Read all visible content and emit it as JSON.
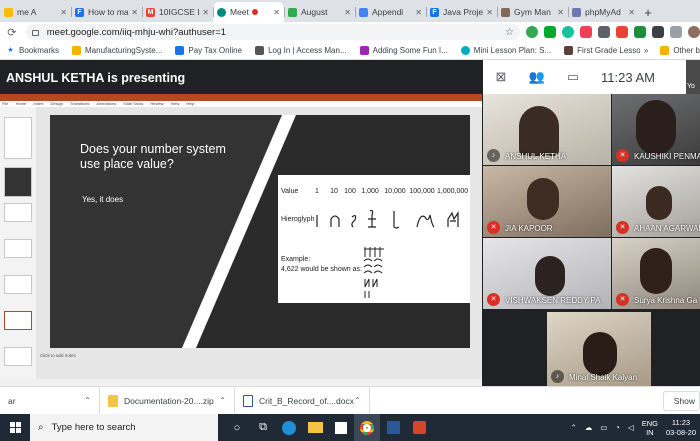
{
  "browser": {
    "tabs": [
      {
        "label": "me A",
        "favicon_color": "#fbbc04",
        "favicon_text": ""
      },
      {
        "label": "How to ma",
        "favicon_color": "#1a73e8",
        "favicon_text": "F"
      },
      {
        "label": "10IGCSE In",
        "favicon_color": "#ea4335",
        "favicon_text": "M"
      },
      {
        "label": "Meet",
        "favicon_color": "#00897b",
        "favicon_text": ""
      },
      {
        "label": "August",
        "favicon_color": "#34a853",
        "favicon_text": ""
      },
      {
        "label": "Appendi",
        "favicon_color": "#4285f4",
        "favicon_text": ""
      },
      {
        "label": "Java Proje",
        "favicon_color": "#1a73e8",
        "favicon_text": "F"
      },
      {
        "label": "Gym Man",
        "favicon_color": "#7f6a55",
        "favicon_text": ""
      },
      {
        "label": "phpMyAd",
        "favicon_color": "#6c78af",
        "favicon_text": ""
      }
    ],
    "new_tab": "+",
    "url": "meet.google.com/iiq-mhju-whi?authuser=1",
    "bookmarks": [
      {
        "label": "Bookmarks",
        "color": "#fbbc04"
      },
      {
        "label": "ManufacturingSyste...",
        "color": "#f4b400"
      },
      {
        "label": "Pay Tax Online",
        "color": "#1a73e8"
      },
      {
        "label": "Log In | Access Man...",
        "color": "#555555"
      },
      {
        "label": "Adding Some Fun I...",
        "color": "#9c27b0"
      },
      {
        "label": "Mini Lesson Plan: S...",
        "color": "#00acc1"
      },
      {
        "label": "First Grade Lesson...",
        "color": "#5d4037"
      }
    ],
    "bookmarks_more": "»",
    "other_bookmarks": "Other b"
  },
  "meet": {
    "presenting_banner": "ANSHUL KETHA is presenting",
    "clock": "11:23 AM",
    "self_label": "Yo",
    "slide": {
      "question": "Does your number system use place value?",
      "answer": "Yes, it does",
      "value_label": "Value",
      "hieroglyph_label": "Hieroglyph",
      "values": [
        "1",
        "10",
        "100",
        "1,000",
        "10,000",
        "100,000",
        "1,000,000"
      ],
      "example_line1": "Example:",
      "example_line2": "4,622 would be shown as:"
    },
    "ppt": {
      "menu": [
        "File",
        "Home",
        "Insert",
        "Design",
        "Transitions",
        "Animations",
        "Slide Show",
        "Review",
        "View",
        "Help"
      ],
      "notes_placeholder": "Click to add notes"
    },
    "participants": [
      {
        "name": "ANSHUL KETHA",
        "muted": false
      },
      {
        "name": "KAUSHIKI PENMATSA",
        "muted": true
      },
      {
        "name": "JIA KAPOOR",
        "muted": true
      },
      {
        "name": "AHAAN AGARWAL",
        "muted": true
      },
      {
        "name": "VISHWAKSEN REDDY PA",
        "muted": true
      },
      {
        "name": "Surya Krishna Ga",
        "muted": true
      },
      {
        "name": "Minal Shaik Kalyan",
        "muted": false
      }
    ]
  },
  "downloads": {
    "items": [
      {
        "label": "ar",
        "color": "#ffffff"
      },
      {
        "label": "Documentation-20....zip",
        "color": "#f4c542"
      },
      {
        "label": "Crit_B_Record_of....docx",
        "color": "#2b579a"
      }
    ],
    "show_all": "Show"
  },
  "taskbar": {
    "search_placeholder": "Type here to search",
    "lang_line1": "ENG",
    "lang_line2": "IN",
    "time": "11:23",
    "date": "03-08-20"
  }
}
